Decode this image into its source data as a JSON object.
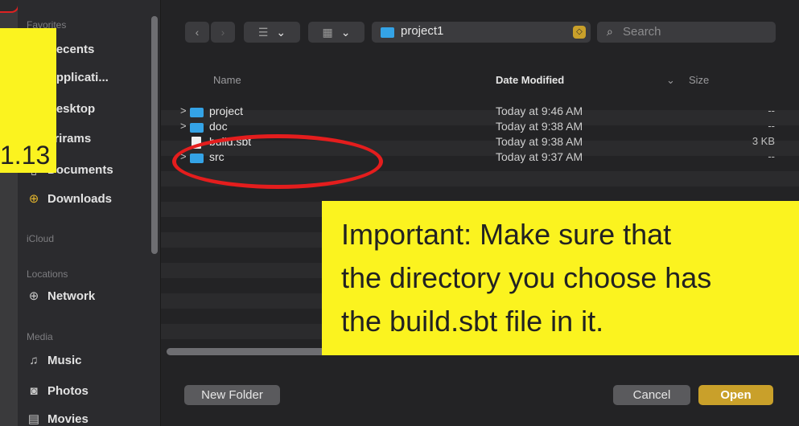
{
  "sidebar": {
    "sections": [
      {
        "id": "favorites",
        "label": "Favorites"
      },
      {
        "id": "icloud",
        "label": "iCloud"
      },
      {
        "id": "locations",
        "label": "Locations"
      },
      {
        "id": "media",
        "label": "Media"
      }
    ],
    "items": [
      {
        "label": "Recents",
        "icon": "clock-icon"
      },
      {
        "label": "Applicati...",
        "icon": "applications-icon"
      },
      {
        "label": "Desktop",
        "icon": "desktop-icon"
      },
      {
        "label": "srirams",
        "icon": "home-icon"
      },
      {
        "label": "Documents",
        "icon": "document-icon"
      },
      {
        "label": "Downloads",
        "icon": "download-icon",
        "glyph": "⊕"
      },
      {
        "label": "Network",
        "icon": "globe-icon",
        "glyph": "⊕"
      },
      {
        "label": "Music",
        "icon": "music-icon",
        "glyph": "♫"
      },
      {
        "label": "Photos",
        "icon": "camera-icon",
        "glyph": "◙"
      },
      {
        "label": "Movies",
        "icon": "film-icon",
        "glyph": "▤"
      }
    ]
  },
  "toolbar": {
    "back_glyph": "‹",
    "forward_glyph": "›",
    "list_view_glyph": "☰",
    "grid_view_glyph": "▦",
    "dropdown_glyph": "⌄",
    "path_label": "project1",
    "search_placeholder": "Search",
    "search_glyph": "⌕",
    "stepper_glyph": "◇"
  },
  "columns": {
    "name": "Name",
    "date": "Date Modified",
    "sort_glyph": "⌄",
    "size": "Size"
  },
  "files": [
    {
      "name": "project",
      "date": "Today at 9:46 AM",
      "size": "--",
      "type": "folder"
    },
    {
      "name": "doc",
      "date": "Today at 9:38 AM",
      "size": "--",
      "type": "folder"
    },
    {
      "name": "build.sbt",
      "date": "Today at 9:38 AM",
      "size": "3 KB",
      "type": "file"
    },
    {
      "name": "src",
      "date": "Today at 9:37 AM",
      "size": "--",
      "type": "folder"
    }
  ],
  "buttons": {
    "new_folder": "New Folder",
    "cancel": "Cancel",
    "open": "Open"
  },
  "callout_left": {
    "text": "1.13"
  },
  "callout_main": {
    "line1": "Important: Make sure that",
    "line2": "the directory you choose has",
    "line3": "the build.sbt file in it."
  },
  "colors": {
    "accent": "#c9a02a",
    "folder": "#34a3e6",
    "highlight": "#fbf31f",
    "annotation_red": "#e41d1d"
  }
}
